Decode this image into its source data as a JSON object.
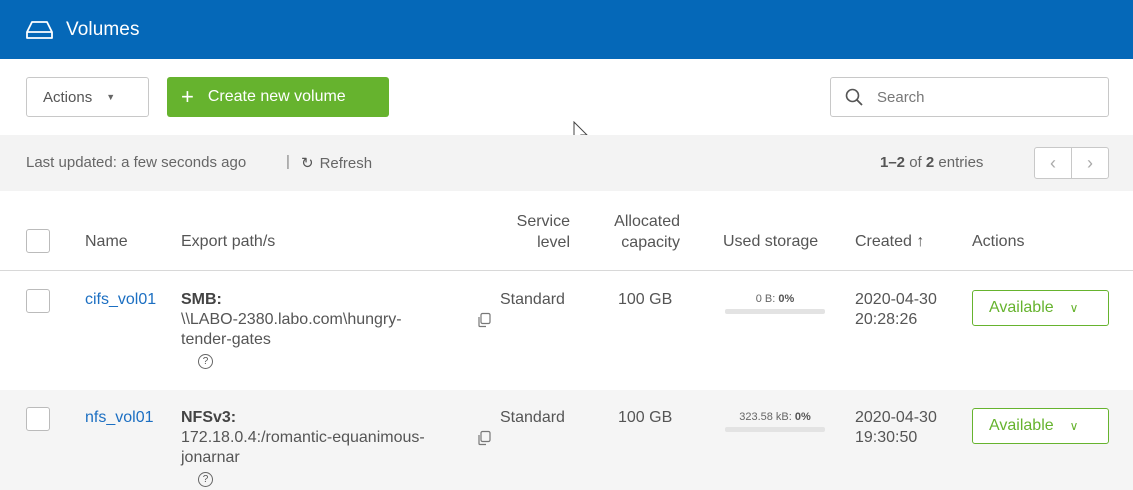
{
  "header": {
    "title": "Volumes",
    "icon": "drive-icon",
    "color": "#0568b8"
  },
  "toolbar": {
    "actions_label": "Actions",
    "create_label": "Create new volume",
    "search_placeholder": "Search"
  },
  "status": {
    "updated": "Last updated: a few seconds ago",
    "separator": "|",
    "refresh": "Refresh",
    "range": "1–2",
    "of": "of",
    "total": "2",
    "entries": "entries"
  },
  "table": {
    "headers": {
      "name": "Name",
      "export": "Export path/s",
      "service_1": "Service",
      "service_2": "level",
      "alloc_1": "Allocated",
      "alloc_2": "capacity",
      "used": "Used storage",
      "created": "Created ↑",
      "actions": "Actions"
    },
    "rows": [
      {
        "name": "cifs_vol01",
        "protocol": "SMB:",
        "path_1": "\\\\LABO-2380.labo.com\\hungry-",
        "path_2": "tender-gates",
        "service": "Standard",
        "capacity": "100 GB",
        "used_amount": "0 B:",
        "used_pct": "0%",
        "created_date": "2020-04-30",
        "created_time": "20:28:26",
        "status": "Available"
      },
      {
        "name": "nfs_vol01",
        "protocol": "NFSv3:",
        "path_1": "172.18.0.4:/romantic-equanimous-",
        "path_2": "jonarnar",
        "service": "Standard",
        "capacity": "100 GB",
        "used_amount": "323.58 kB:",
        "used_pct": "0%",
        "created_date": "2020-04-30",
        "created_time": "19:30:50",
        "status": "Available"
      }
    ]
  },
  "colors": {
    "accent_green": "#66b32e",
    "link_blue": "#1c6fc2"
  }
}
